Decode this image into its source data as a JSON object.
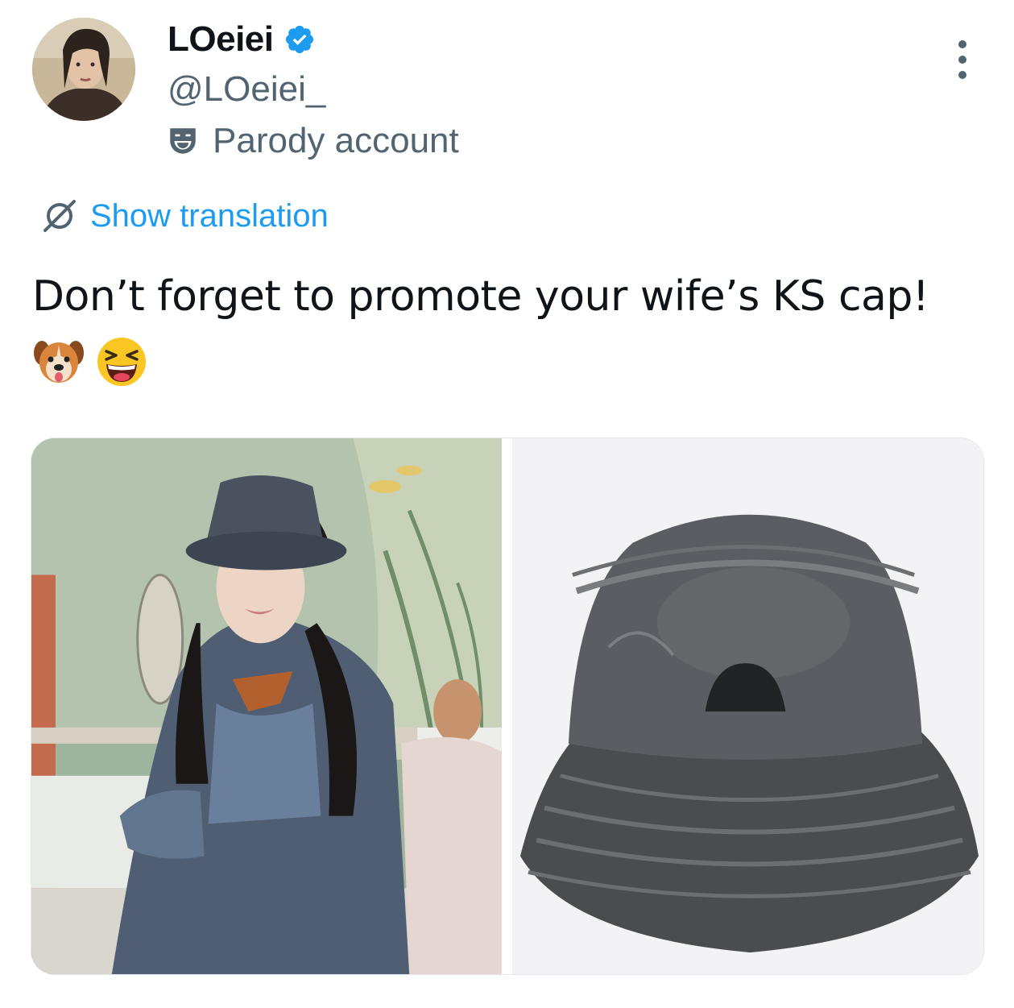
{
  "user": {
    "display_name": "LOeiei",
    "handle": "@LOeiei_",
    "verified": true,
    "avatar_icon": "profile-photo",
    "label": "Parody account",
    "label_icon": "theater-mask-icon"
  },
  "actions": {
    "more_icon": "more-options-icon",
    "translate_label": "Show translation",
    "translate_icon": "translate-globe-icon"
  },
  "tweet": {
    "text": "Don’t forget to promote your wife’s KS cap!",
    "emojis": [
      "dog-face-emoji",
      "grinning-squinting-face-emoji"
    ]
  },
  "media": {
    "photos": [
      {
        "kind": "person wearing denim bucket hat and denim jacket"
      },
      {
        "kind": "grey washed denim bucket hat product photo"
      }
    ]
  },
  "colors": {
    "text_primary": "#0f1419",
    "text_secondary": "#536471",
    "accent": "#1d9bf0"
  }
}
